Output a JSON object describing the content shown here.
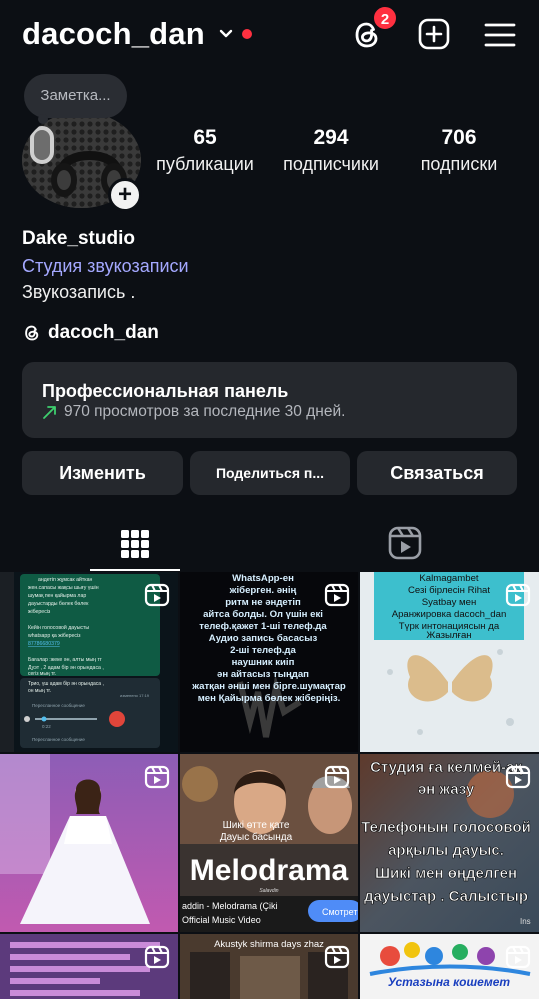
{
  "header": {
    "username": "dacoch_dan",
    "notification_count": "2"
  },
  "profile": {
    "note_placeholder": "Заметка...",
    "stats": [
      {
        "value": "65",
        "label": "публикации"
      },
      {
        "value": "294",
        "label": "подписчики"
      },
      {
        "value": "706",
        "label": "подписки"
      }
    ],
    "name": "Dake_studio",
    "category": "Студия звукозаписи",
    "bio": "Звукозапись .",
    "threads_handle": "dacoch_dan"
  },
  "pro_panel": {
    "title": "Профессиональная панель",
    "subtitle": "970 просмотров за последние 30 дней."
  },
  "actions": {
    "edit": "Изменить",
    "share": "Поделиться п...",
    "contact": "Связаться"
  },
  "posts": [
    {
      "type": "reel",
      "lines": [
        "андетіп жұмсак айткан",
        "жен.сапасы жақсы шығу үшін",
        "шумақ пен қайырма лар",
        "дауыстарды бөлек бөлек",
        "жібересіз",
        "Кейін голосовой дауысты",
        "whatsapp қа жібересіз",
        "87786680379",
        "Бағалар :жеке ән, алты мың тг",
        "Дуэт , 2 адам бір ән орындаса ,",
        "сегіз мың тг.",
        "Трио, үш адам бір ән орындаса ,",
        "он мың тг."
      ],
      "meta": [
        "Пересланное сообщение",
        "0:22",
        "Пересланное сообщение",
        "изменено 17:19"
      ]
    },
    {
      "type": "reel",
      "lines": [
        "WhatsApp-ен",
        "жіберген. әнің",
        "ритм не әндетіп",
        "айтса болды. Ол үшін екі",
        "телеф.қажет 1-ші телеф.да",
        "Аудио запись басасыз",
        "2-ші телеф.да",
        "наушник киіп",
        "ән айтасыз тыңдап",
        "жатқан әнші мен бірге.шумақтар",
        "мен Қайырма бөлек жіберіңіз."
      ]
    },
    {
      "type": "reel",
      "lines": [
        "Kalmagambet",
        "Сезі бірлесін Rihat",
        "Syatbay мен",
        "Аранжировка dacoch_dan",
        "Түрк интонациясын да",
        "Жазылған"
      ]
    },
    {
      "type": "reel"
    },
    {
      "type": "reel",
      "lines": [
        "Шикі өтте қате",
        "Дауыс басында"
      ],
      "title": "Melodrama",
      "artist": "Salavdin",
      "caption": "addin - Melodrama (Çiki",
      "caption2": "Official Music Video",
      "watch_label": "Смотрет"
    },
    {
      "type": "reel",
      "lines": [
        "Студия ға келмей-ақ",
        "ән жазу",
        "Телефонын голосовой",
        "арқылы дауыс.",
        "Шикі мен өңделген",
        "дауыстар . Салыстыр"
      ],
      "watermark": "Ins"
    },
    {
      "type": "reel"
    },
    {
      "type": "reel",
      "lines": [
        "Akustyk shirma days zhaz"
      ]
    },
    {
      "type": "reel",
      "lines": [
        "Устазына кошемет"
      ]
    }
  ],
  "colors": {
    "background": "#0c0f14",
    "accent": "#ff3040",
    "link": "#a4a8ff",
    "card": "#25282d"
  }
}
